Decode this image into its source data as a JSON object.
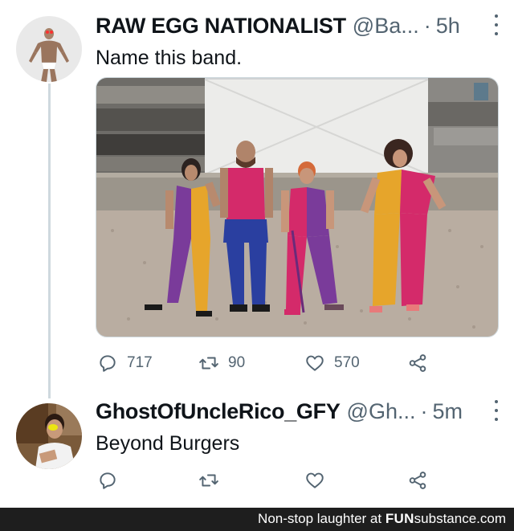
{
  "tweets": [
    {
      "name": "RAW EGG NATIONALIST",
      "handle": "@Ba...",
      "separator": "·",
      "time": "5h",
      "text": "Name this band.",
      "counts": {
        "replies": "717",
        "retweets": "90",
        "likes": "570"
      }
    },
    {
      "name": "GhostOfUncleRico_GFY",
      "handle": "@Gh...",
      "separator": "·",
      "time": "5m",
      "text": "Beyond Burgers",
      "counts": {
        "replies": "",
        "retweets": "",
        "likes": ""
      }
    }
  ],
  "footer": {
    "prefix": "Non-stop laughter at ",
    "brand_fun": "FUN",
    "brand_rest": "substance.com"
  },
  "icons": {
    "reply": "reply-icon",
    "retweet": "retweet-icon",
    "like": "heart-icon",
    "share": "share-icon",
    "more": "more-options-icon"
  },
  "colors": {
    "text": "#0f1419",
    "secondary": "#536471",
    "thread_line": "#cfd9de",
    "footer_bg": "#1e1e1e"
  }
}
